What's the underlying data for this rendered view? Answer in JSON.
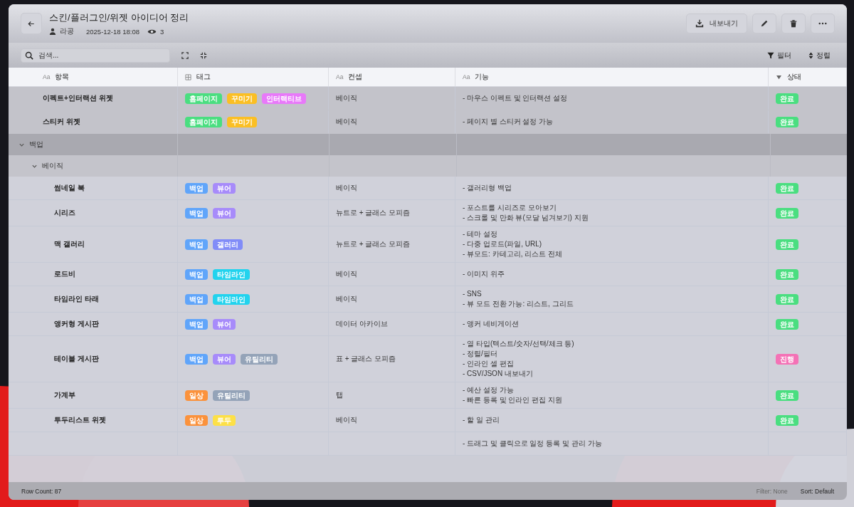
{
  "header": {
    "title": "스킨/플러그인/위젯 아이디어 정리",
    "author": "라공",
    "date": "2025-12-18 18:08",
    "views": "3",
    "export_label": "내보내기"
  },
  "toolbar": {
    "search_placeholder": "검색...",
    "filter_label": "필터",
    "sort_label": "정렬"
  },
  "columns": [
    {
      "kind": "text",
      "type_label": "Aa",
      "label": "항목"
    },
    {
      "kind": "multi",
      "label": "태그"
    },
    {
      "kind": "text",
      "type_label": "Aa",
      "label": "컨셉"
    },
    {
      "kind": "text",
      "type_label": "Aa",
      "label": "기능"
    },
    {
      "kind": "select",
      "label": "상태"
    }
  ],
  "rows": [
    {
      "kind": "item",
      "name": "이펙트+인터랙션 위젯",
      "tags": [
        {
          "label": "홈페이지",
          "color": "#4ade80"
        },
        {
          "label": "꾸미기",
          "color": "#fbbf24"
        },
        {
          "label": "인터랙티브",
          "color": "#e879f9"
        }
      ],
      "concept": "베이직",
      "features": [
        "- 마우스 이펙트 및 인터랙션 설정"
      ],
      "status": {
        "label": "완료",
        "color": "#4ade80"
      }
    },
    {
      "kind": "item",
      "name": "스티커 위젯",
      "tags": [
        {
          "label": "홈페이지",
          "color": "#4ade80"
        },
        {
          "label": "꾸미기",
          "color": "#fbbf24"
        }
      ],
      "concept": "베이직",
      "features": [
        "- 페이지 별 스티커 설정 가능"
      ],
      "status": {
        "label": "완료",
        "color": "#4ade80"
      }
    },
    {
      "kind": "group",
      "label": "백업",
      "expanded": true,
      "children": [
        {
          "kind": "group",
          "label": "베이직",
          "expanded": true,
          "children": [
            {
              "kind": "item",
              "name": "썸네일 북",
              "tags": [
                {
                  "label": "백업",
                  "color": "#60a5fa"
                },
                {
                  "label": "뷰어",
                  "color": "#a78bfa"
                }
              ],
              "concept": "베이직",
              "features": [
                "- 갤러리형 백업"
              ],
              "status": {
                "label": "완료",
                "color": "#4ade80"
              }
            },
            {
              "kind": "item",
              "name": "시리즈",
              "tags": [
                {
                  "label": "백업",
                  "color": "#60a5fa"
                },
                {
                  "label": "뷰어",
                  "color": "#a78bfa"
                }
              ],
              "concept": "뉴트로 + 글래스 모피즘",
              "features": [
                "- 포스트를 시리즈로 모아보기",
                "- 스크롤 및 만화 뷰(모달 넘겨보기) 지원"
              ],
              "status": {
                "label": "완료",
                "color": "#4ade80"
              }
            },
            {
              "kind": "item",
              "name": "맥 갤러리",
              "tags": [
                {
                  "label": "백업",
                  "color": "#60a5fa"
                },
                {
                  "label": "갤러리",
                  "color": "#818cf8"
                }
              ],
              "concept": "뉴트로 + 글래스 모피즘",
              "features": [
                "- 테마 설정",
                "- 다중 업로드(파일, URL)",
                "- 뷰모드: 카테고리, 리스트 전체"
              ],
              "status": {
                "label": "완료",
                "color": "#4ade80"
              }
            },
            {
              "kind": "item",
              "name": "로드비",
              "tags": [
                {
                  "label": "백업",
                  "color": "#60a5fa"
                },
                {
                  "label": "타임라인",
                  "color": "#22d3ee"
                }
              ],
              "concept": "베이직",
              "features": [
                "- 이미지 위주"
              ],
              "status": {
                "label": "완료",
                "color": "#4ade80"
              }
            },
            {
              "kind": "item",
              "name": "타임라인 타래",
              "tags": [
                {
                  "label": "백업",
                  "color": "#60a5fa"
                },
                {
                  "label": "타임라인",
                  "color": "#22d3ee"
                }
              ],
              "concept": "베이직",
              "features": [
                "- SNS",
                "- 뷰 모드 전환 가능: 리스트, 그리드"
              ],
              "status": {
                "label": "완료",
                "color": "#4ade80"
              }
            },
            {
              "kind": "item",
              "name": "앵커형 게시판",
              "tags": [
                {
                  "label": "백업",
                  "color": "#60a5fa"
                },
                {
                  "label": "뷰어",
                  "color": "#a78bfa"
                }
              ],
              "concept": "데이터 아카이브",
              "features": [
                "- 앵커 네비게이션"
              ],
              "status": {
                "label": "완료",
                "color": "#4ade80"
              }
            },
            {
              "kind": "item",
              "name": "테이블 게시판",
              "tags": [
                {
                  "label": "백업",
                  "color": "#60a5fa"
                },
                {
                  "label": "뷰어",
                  "color": "#a78bfa"
                },
                {
                  "label": "유틸리티",
                  "color": "#94a3b8"
                }
              ],
              "concept": "표 + 글래스 모피즘",
              "features": [
                "- 열 타입(텍스트/숫자/선택/체크 등)",
                "- 정렬/필터",
                "- 인라인 셀 편집",
                "- CSV/JSON 내보내기"
              ],
              "status": {
                "label": "진행",
                "color": "#f472b6"
              }
            },
            {
              "kind": "item",
              "name": "가계부",
              "tags": [
                {
                  "label": "일상",
                  "color": "#fb923c"
                },
                {
                  "label": "유틸리티",
                  "color": "#94a3b8"
                }
              ],
              "concept": "탭",
              "features": [
                "- 예산 설정 가능",
                "- 빠른 등록 및 인라인 편집 지원"
              ],
              "status": {
                "label": "완료",
                "color": "#4ade80"
              }
            },
            {
              "kind": "item",
              "name": "투두리스트 위젯",
              "tags": [
                {
                  "label": "일상",
                  "color": "#fb923c"
                },
                {
                  "label": "투두",
                  "color": "#fde047"
                }
              ],
              "concept": "베이직",
              "features": [
                "- 할 일 관리"
              ],
              "status": {
                "label": "완료",
                "color": "#4ade80"
              }
            },
            {
              "kind": "item",
              "features": [
                "- 드래그 및 클릭으로 일정 등록 및 관리 가능"
              ]
            }
          ]
        }
      ]
    }
  ],
  "footer": {
    "row_count": "Row Count: 87",
    "filter": "Filter: None",
    "sort": "Sort: Default"
  }
}
